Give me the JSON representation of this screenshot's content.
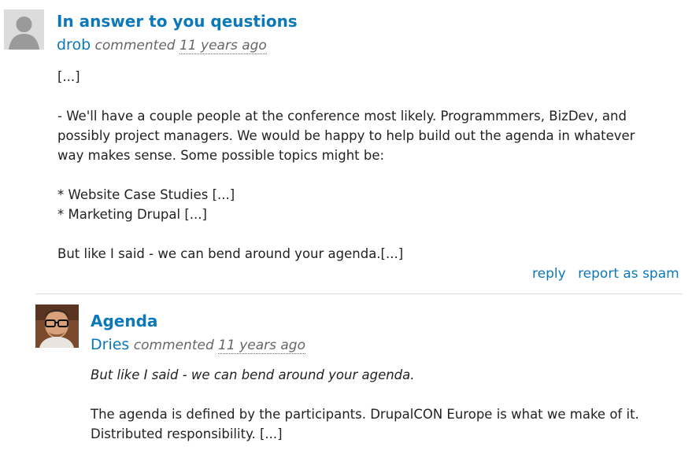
{
  "comments": [
    {
      "title": "In answer to you qeustions",
      "author": "drob",
      "verb": "commented",
      "time": "11 years ago",
      "avatar_icon": "default-user-avatar-icon",
      "body": [
        "[...]",
        "",
        "- We'll have a couple people at the conference most likely. Programmmers, BizDev, and",
        "possibly project managers. We would be happy to help build out the agenda in whatever",
        "way makes sense. Some possible topics might be:",
        "",
        "* Website Case Studies [...]",
        "* Marketing Drupal [...]",
        "",
        "But like I said - we can bend around your agenda.[...]"
      ],
      "links": {
        "reply": "reply",
        "spam": "report as spam"
      }
    },
    {
      "title": "Agenda",
      "author": "Dries",
      "verb": "commented",
      "time": "11 years ago",
      "avatar_icon": "user-photo-avatar-icon",
      "quote": "But like I said - we can bend around your agenda.",
      "body": [
        "The agenda is defined by the participants. DrupalCON Europe is what we make of it.",
        "Distributed responsibility. [...]"
      ]
    }
  ],
  "colors": {
    "link": "#0b78b9",
    "meta": "#666666",
    "text": "#222222"
  }
}
